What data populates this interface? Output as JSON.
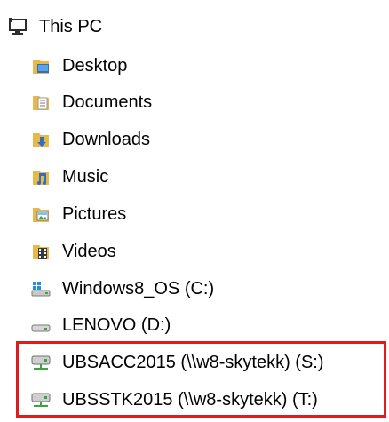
{
  "tree": {
    "root": {
      "label": "This PC",
      "icon": "this-pc-icon"
    },
    "items": [
      {
        "label": "Desktop",
        "icon": "desktop-folder-icon"
      },
      {
        "label": "Documents",
        "icon": "documents-folder-icon"
      },
      {
        "label": "Downloads",
        "icon": "downloads-folder-icon"
      },
      {
        "label": "Music",
        "icon": "music-folder-icon"
      },
      {
        "label": "Pictures",
        "icon": "pictures-folder-icon"
      },
      {
        "label": "Videos",
        "icon": "videos-folder-icon"
      },
      {
        "label": "Windows8_OS (C:)",
        "icon": "windows-drive-icon"
      },
      {
        "label": "LENOVO (D:)",
        "icon": "drive-icon"
      },
      {
        "label": "UBSACC2015 (\\\\w8-skytekk) (S:)",
        "icon": "network-drive-icon"
      },
      {
        "label": "UBSSTK2015 (\\\\w8-skytekk) (T:)",
        "icon": "network-drive-icon"
      }
    ]
  },
  "colors": {
    "highlight_border": "#e01b1b",
    "folder": "#e8b94a",
    "network_green": "#3aa53a"
  }
}
